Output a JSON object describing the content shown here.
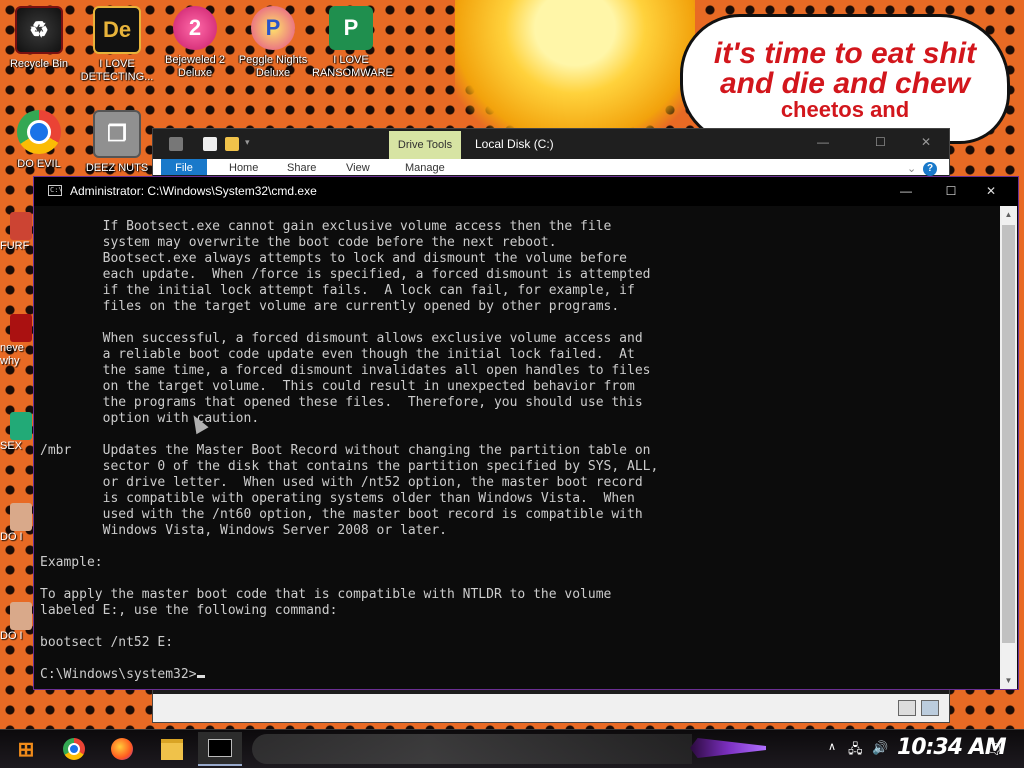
{
  "wallpaper": {
    "speech_line1": "it's time to eat shit",
    "speech_line2": "and die and chew",
    "speech_line3": "cheetos and"
  },
  "desktop_icons": [
    {
      "label": "Recycle Bin",
      "icon": "recycle-bin-icon",
      "color": "#7a1010"
    },
    {
      "label": "I LOVE DETECTING...",
      "icon": "detecting-app-icon",
      "color": "#e7b33a"
    },
    {
      "label": "Bejeweled 2 Deluxe",
      "icon": "bejeweled-icon",
      "color": "#c81c6a"
    },
    {
      "label": "Peggle Nights Deluxe",
      "icon": "peggle-icon",
      "color": "#e24a8c"
    },
    {
      "label": "I LOVE RANSOMWARE",
      "icon": "ransomware-icon",
      "color": "#1f8f4e"
    },
    {
      "label": "DO EVIL",
      "icon": "chrome-icon",
      "color": "#1a73e8"
    },
    {
      "label": "DEEZ NUTS",
      "icon": "copy-files-icon",
      "color": "#909090"
    }
  ],
  "side_icons": [
    {
      "label": "FURF"
    },
    {
      "label": "neve why"
    },
    {
      "label": "SEX"
    },
    {
      "label": "DO I"
    },
    {
      "label": "DO I"
    }
  ],
  "explorer": {
    "context_tab": "Drive Tools",
    "title": "Local Disk (C:)",
    "tabs": [
      "File",
      "Home",
      "Share",
      "View",
      "Manage"
    ]
  },
  "cmd": {
    "title": "Administrator: C:\\Windows\\System32\\cmd.exe",
    "lines": [
      "        If Bootsect.exe cannot gain exclusive volume access then the file",
      "        system may overwrite the boot code before the next reboot.",
      "        Bootsect.exe always attempts to lock and dismount the volume before",
      "        each update.  When /force is specified, a forced dismount is attempted",
      "        if the initial lock attempt fails.  A lock can fail, for example, if",
      "        files on the target volume are currently opened by other programs.",
      "",
      "        When successful, a forced dismount allows exclusive volume access and",
      "        a reliable boot code update even though the initial lock failed.  At",
      "        the same time, a forced dismount invalidates all open handles to files",
      "        on the target volume.  This could result in unexpected behavior from",
      "        the programs that opened these files.  Therefore, you should use this",
      "        option with caution.",
      "",
      "/mbr    Updates the Master Boot Record without changing the partition table on",
      "        sector 0 of the disk that contains the partition specified by SYS, ALL,",
      "        or drive letter.  When used with /nt52 option, the master boot record",
      "        is compatible with operating systems older than Windows Vista.  When",
      "        used with the /nt60 option, the master boot record is compatible with",
      "        Windows Vista, Windows Server 2008 or later.",
      "",
      "Example:",
      "",
      "To apply the master boot code that is compatible with NTLDR to the volume",
      "labeled E:, use the following command:",
      "",
      "bootsect /nt52 E:",
      ""
    ],
    "prompt": "C:\\Windows\\system32>"
  },
  "taskbar": {
    "clock": "10:34 AM",
    "pinned": [
      "start-button",
      "chrome-icon",
      "firefox-icon",
      "file-explorer-icon",
      "cmd-icon"
    ]
  }
}
